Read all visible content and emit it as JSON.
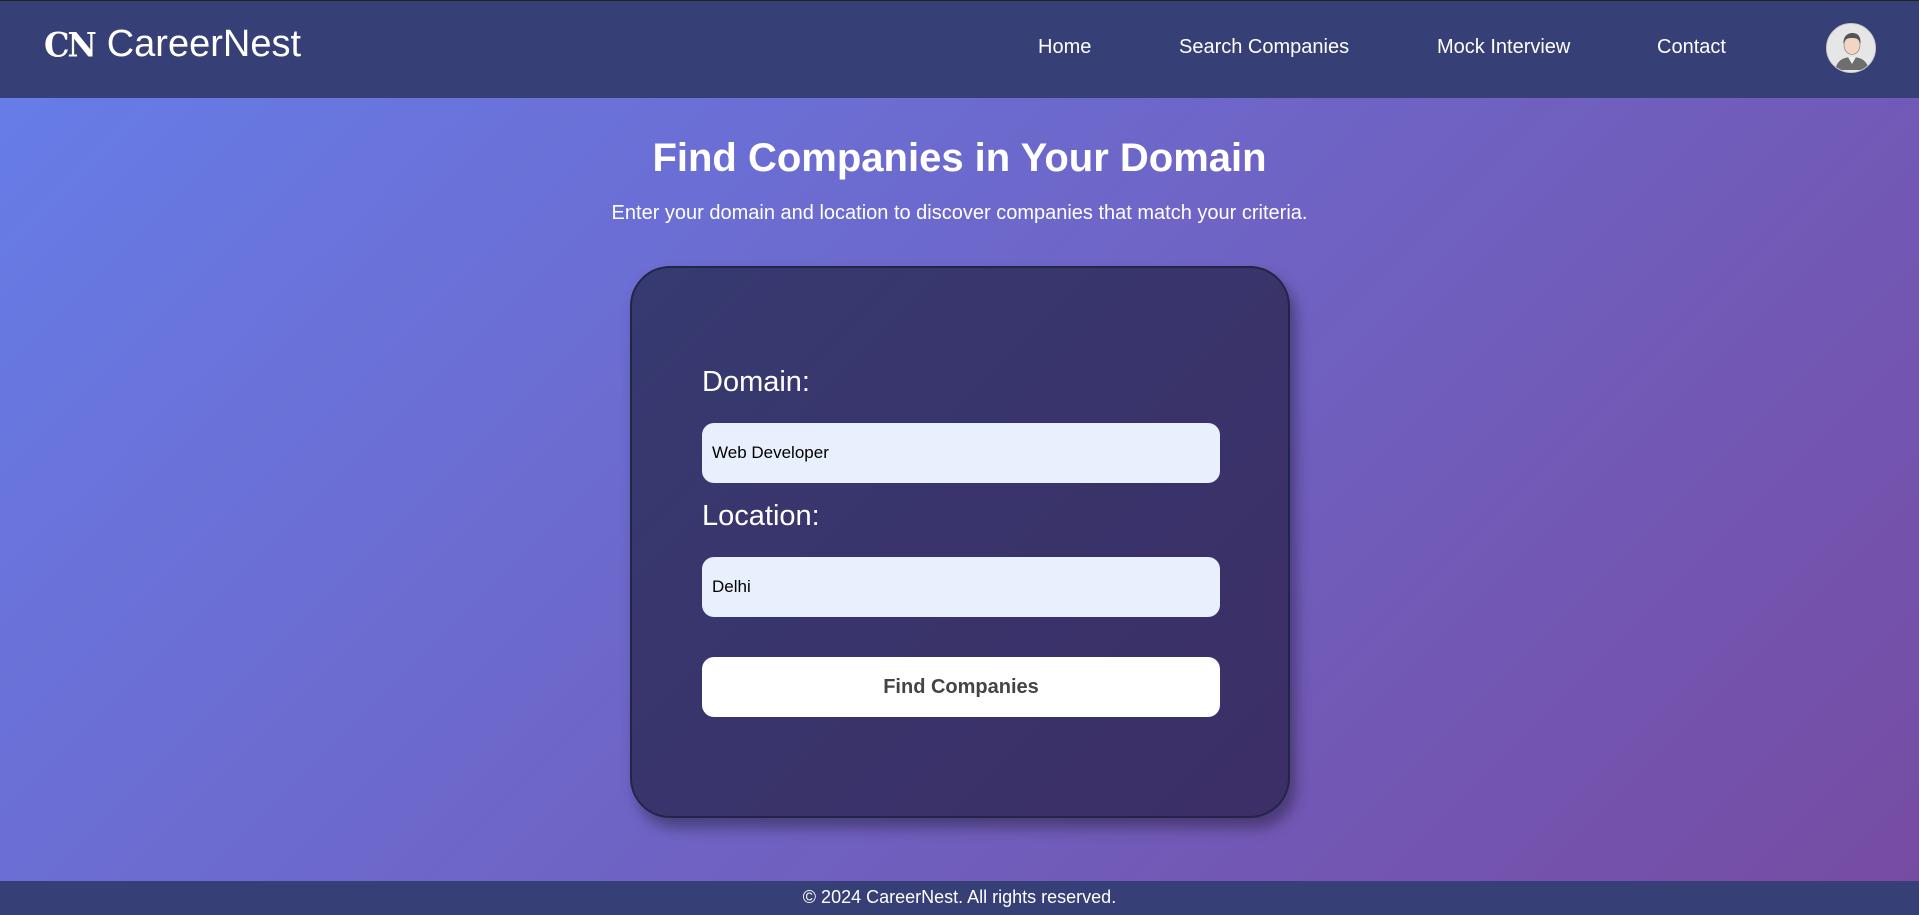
{
  "navbar": {
    "logo_mark": "CN",
    "brand": "CareerNest",
    "links": [
      "Home",
      "Search Companies",
      "Mock Interview",
      "Contact"
    ],
    "avatar_icon": "user-avatar-icon"
  },
  "hero": {
    "title": "Find Companies in Your Domain",
    "subtitle": "Enter your domain and location to discover companies that match your criteria."
  },
  "form": {
    "domain_label": "Domain:",
    "domain_value": "Web Developer",
    "location_label": "Location:",
    "location_value": "Delhi",
    "submit_label": "Find Companies"
  },
  "footer": {
    "text": "© 2024 CareerNest. All rights reserved."
  },
  "colors": {
    "navbar_bg": "#363f76",
    "gradient_start": "#667eea",
    "gradient_end": "#764ba2",
    "card_bg": "#373768",
    "input_bg": "#e8f0fe"
  }
}
